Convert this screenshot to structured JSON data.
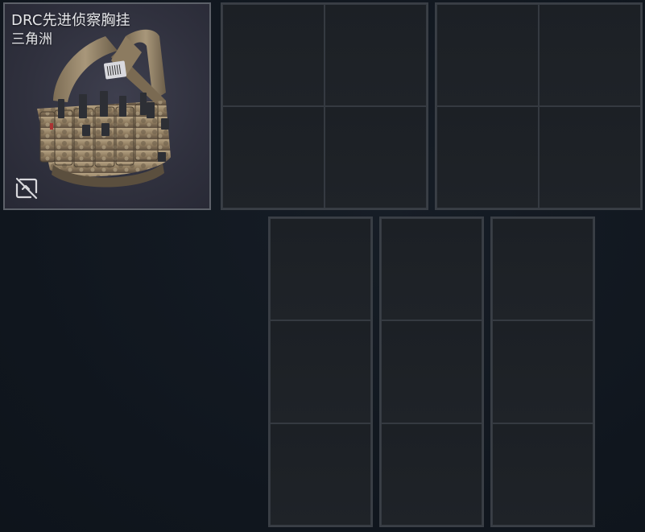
{
  "item": {
    "name": "DRC先进侦察胸挂",
    "subtitle": "三角洲",
    "image_icon": "chest-rig-image",
    "status_icon": "untradeable-icon",
    "card_color": "#34353f",
    "border_color": "#5d6169"
  },
  "storage": {
    "top_grids": [
      {
        "columns": 2,
        "rows": 2
      },
      {
        "columns": 2,
        "rows": 2
      }
    ],
    "bottom_columns": [
      {
        "columns": 1,
        "rows": 3
      },
      {
        "columns": 1,
        "rows": 3
      },
      {
        "columns": 1,
        "rows": 3
      }
    ],
    "cell_color": "#1e2227",
    "background_color": "#121820"
  }
}
